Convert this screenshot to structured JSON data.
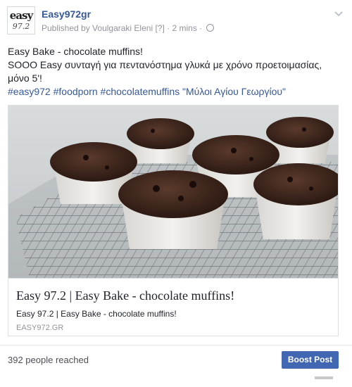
{
  "post": {
    "page_name": "Easy972gr",
    "logo": {
      "line1": "easy",
      "line2": "97.2"
    },
    "published_by": "Published by Voulgaraki Eleni",
    "help_marker": "[?]",
    "time": "2 mins",
    "separator": "·",
    "audience_icon": "globe-icon",
    "menu_icon": "chevron-down-icon",
    "text_line1": "Easy Bake - chocolate muffins!",
    "text_line2": "SOOO Easy συνταγή για πεντανόστημα γλυκά με χρόνο προετοιμασίας, μόνο 5'!",
    "hashtags": "#easy972 #foodporn #chocolatemuffins \"Μύλοι Αγίου Γεωργίου\""
  },
  "link_card": {
    "image_subject": "chocolate muffins on a cooling rack",
    "title": "Easy 97.2 | Easy Bake - chocolate muffins!",
    "description": "Easy 97.2 | Easy Bake - chocolate muffins!",
    "domain": "EASY972.GR"
  },
  "footer": {
    "reach": "392 people reached",
    "boost_label": "Boost Post"
  },
  "colors": {
    "link": "#365899",
    "button": "#4267b2",
    "meta": "#90949c"
  }
}
